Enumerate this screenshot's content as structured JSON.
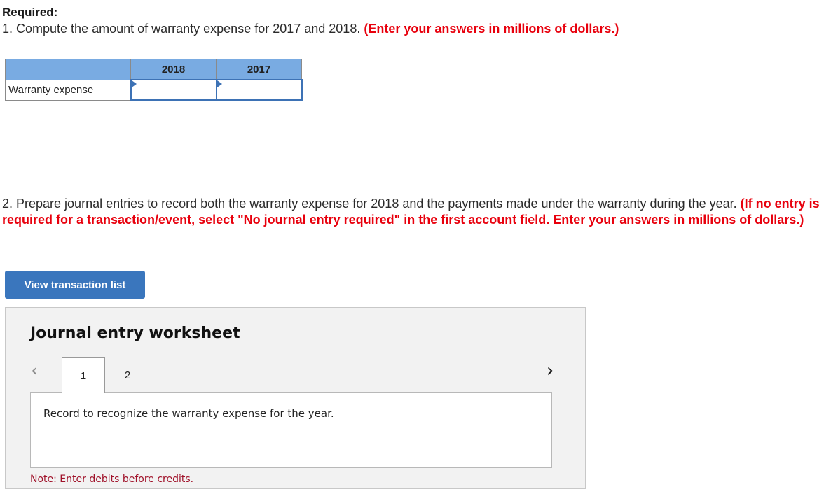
{
  "required": {
    "title": "Required:",
    "q1_text": "1. Compute the amount of warranty expense for 2017 and 2018. ",
    "q1_instruction": "(Enter your answers in millions of dollars.)"
  },
  "expense_table": {
    "columns": [
      "",
      "2018",
      "2017"
    ],
    "rows": [
      {
        "label": "Warranty expense",
        "values": [
          "",
          ""
        ]
      }
    ]
  },
  "q2": {
    "text": "2. Prepare journal entries to record both the warranty expense for 2018 and the payments made under the warranty during the year. ",
    "instruction": "(If no entry is required for a transaction/event, select \"No journal entry required\" in the first account field. Enter your answers in millions of dollars.)"
  },
  "buttons": {
    "view_transaction_list": "View transaction list"
  },
  "worksheet": {
    "title": "Journal entry worksheet",
    "tabs": [
      "1",
      "2"
    ],
    "active_tab": "1",
    "prev_icon": "‹",
    "next_icon": "›",
    "description": "Record to recognize the warranty expense for the year.",
    "note": "Note: Enter debits before credits."
  },
  "colors": {
    "instruction_red": "#e8000d",
    "table_header": "#79abe2",
    "button_blue": "#3a76bd",
    "worksheet_bg": "#f2f2f2"
  }
}
